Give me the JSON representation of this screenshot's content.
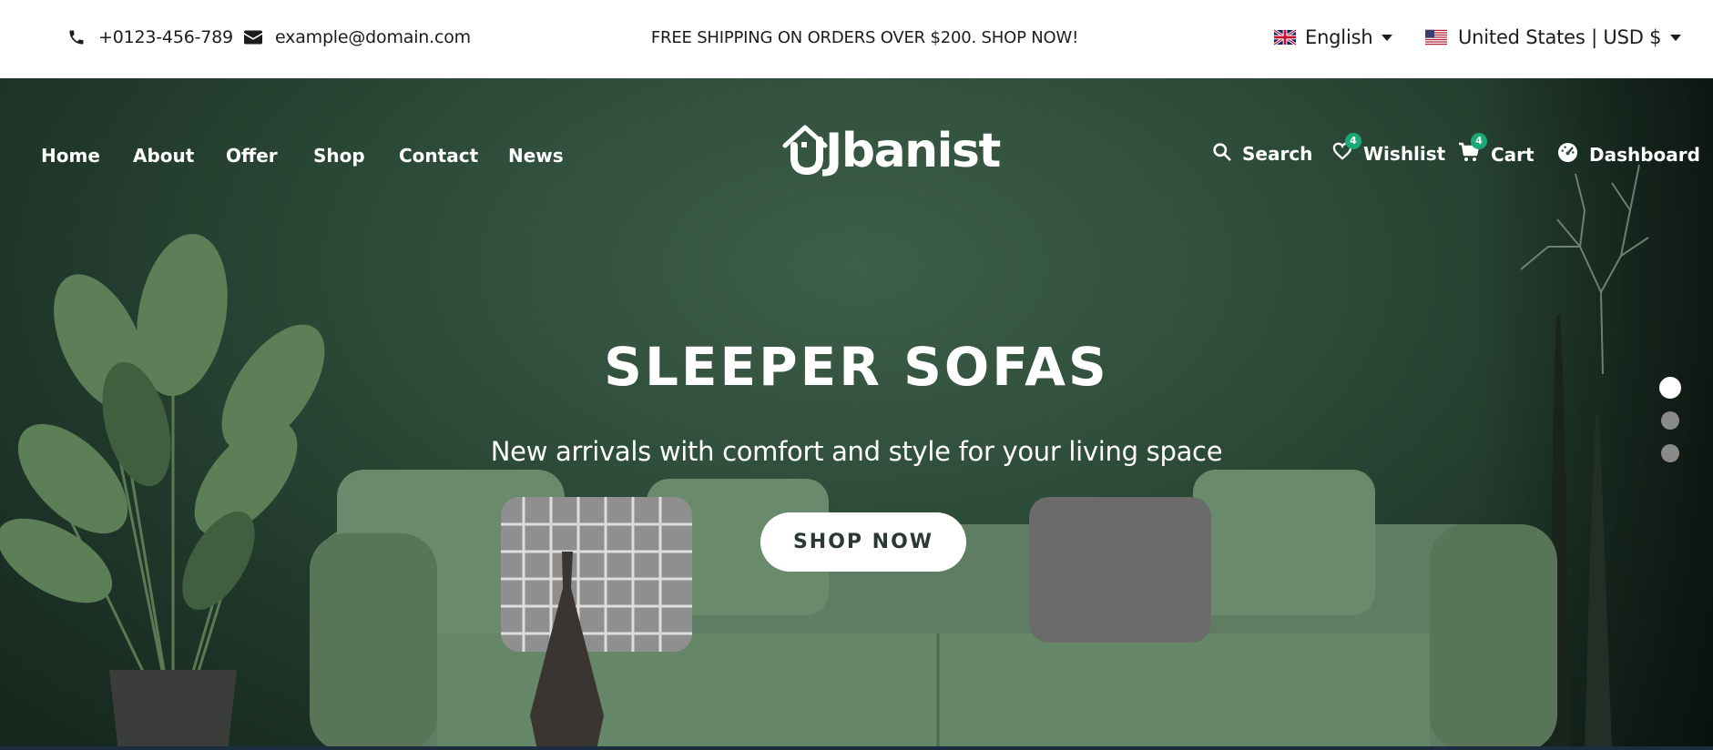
{
  "topbar": {
    "phone": "+0123-456-789",
    "email": "example@domain.com",
    "promo": "FREE SHIPPING ON ORDERS OVER $200. SHOP NOW!",
    "language": "English",
    "currency": "United States | USD $"
  },
  "nav": {
    "left": [
      "Home",
      "About",
      "Offer",
      "Shop",
      "Contact",
      "News"
    ],
    "logo": "Jbanist",
    "search_label": "Search",
    "wishlist_label": "Wishlist",
    "wishlist_count": "4",
    "cart_label": "Cart",
    "cart_count": "4",
    "dashboard_label": "Dashboard"
  },
  "hero": {
    "title": "SLEEPER SOFAS",
    "subtitle": "New arrivals with comfort and style for your living space",
    "cta": "SHOP NOW",
    "active_slide": 1,
    "slide_count": 3
  },
  "colors": {
    "hero_bg": "#2c4a38",
    "badge": "#1aa878",
    "text_dark": "#1c1c1c"
  }
}
